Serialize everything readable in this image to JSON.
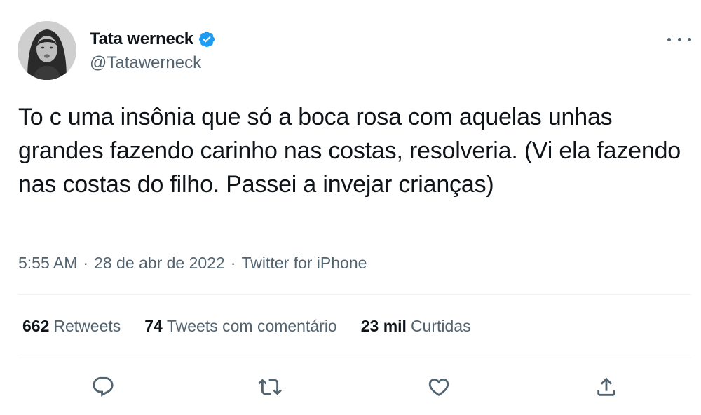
{
  "author": {
    "display_name": "Tata werneck",
    "handle": "@Tatawerneck",
    "verified": true,
    "avatar_icon": "profile-photo"
  },
  "tweet": {
    "text": "To c uma insônia que só a boca rosa com aquelas unhas grandes fazendo carinho nas costas, resolveria. (Vi ela fazendo nas costas do filho. Passei a invejar crianças)",
    "time": "5:55 AM",
    "date": "28 de abr de 2022",
    "separator": "·",
    "source": "Twitter for iPhone"
  },
  "stats": {
    "retweets_count": "662",
    "retweets_label": "Retweets",
    "quotes_count": "74",
    "quotes_label": "Tweets com comentário",
    "likes_count": "23 mil",
    "likes_label": "Curtidas"
  },
  "actions": {
    "reply_icon": "reply-icon",
    "retweet_icon": "retweet-icon",
    "like_icon": "heart-icon",
    "share_icon": "share-icon"
  },
  "colors": {
    "verified_blue": "#1d9bf0",
    "text_primary": "#0f1419",
    "text_secondary": "#536471",
    "divider": "#eff3f4"
  }
}
